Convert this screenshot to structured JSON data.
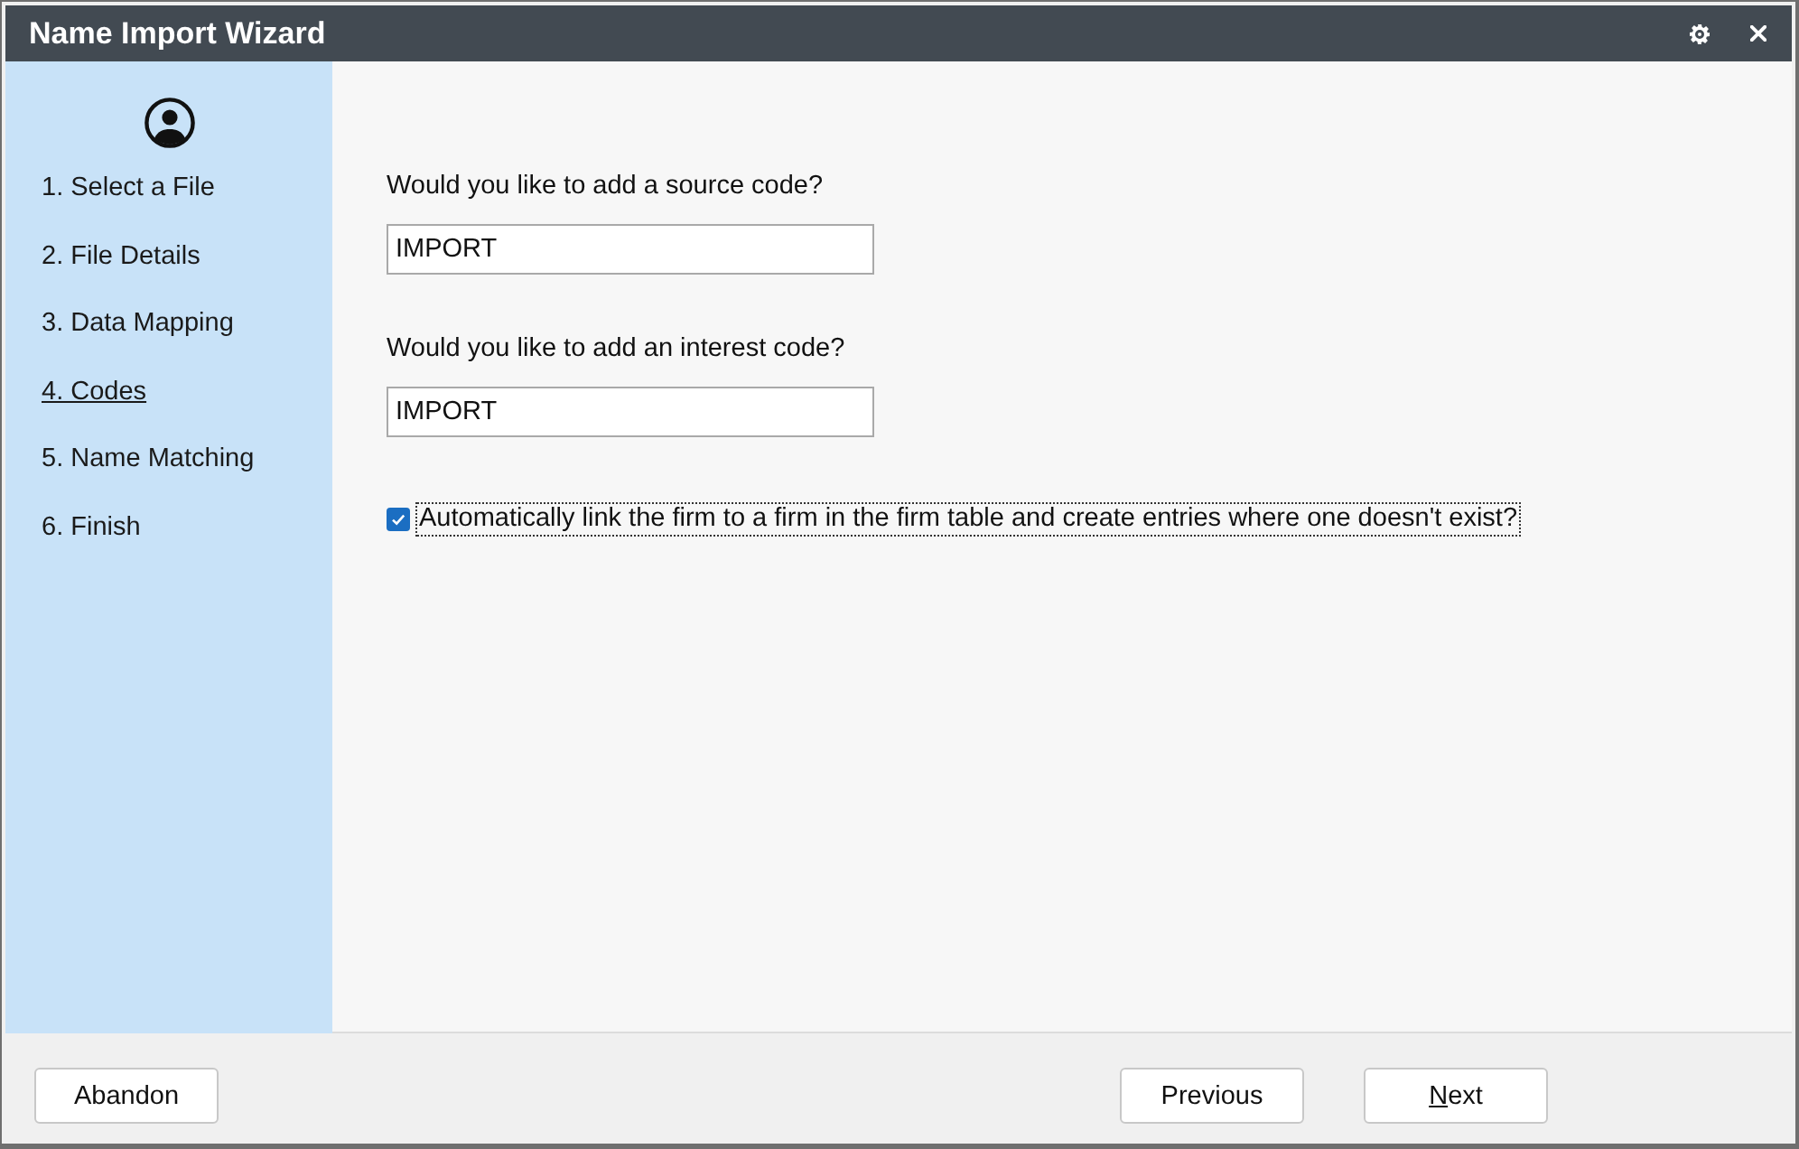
{
  "window": {
    "title": "Name Import Wizard"
  },
  "sidebar": {
    "steps": [
      {
        "label": "1. Select a File",
        "selected": false
      },
      {
        "label": "2. File Details",
        "selected": false
      },
      {
        "label": "3. Data Mapping",
        "selected": false
      },
      {
        "label": "4. Codes",
        "selected": true
      },
      {
        "label": "5. Name Matching",
        "selected": false
      },
      {
        "label": "6. Finish",
        "selected": false
      }
    ]
  },
  "fields": [
    {
      "label": "Would you like to add a source code?",
      "value": "IMPORT"
    },
    {
      "label": "Would you like to add an interest code?",
      "value": "IMPORT"
    }
  ],
  "options": [
    {
      "label": "Automatically link the firm to a firm in the firm table and create entries where one doesn't exist?",
      "checked": true,
      "focused": true
    }
  ],
  "footer": {
    "left_buttons": [
      {
        "label": "Abandon",
        "access_key_underlined": false
      }
    ],
    "right_buttons": [
      {
        "label": "Previous",
        "access_key_underlined": false
      },
      {
        "label": "Next",
        "access_key_underlined": true
      }
    ]
  }
}
